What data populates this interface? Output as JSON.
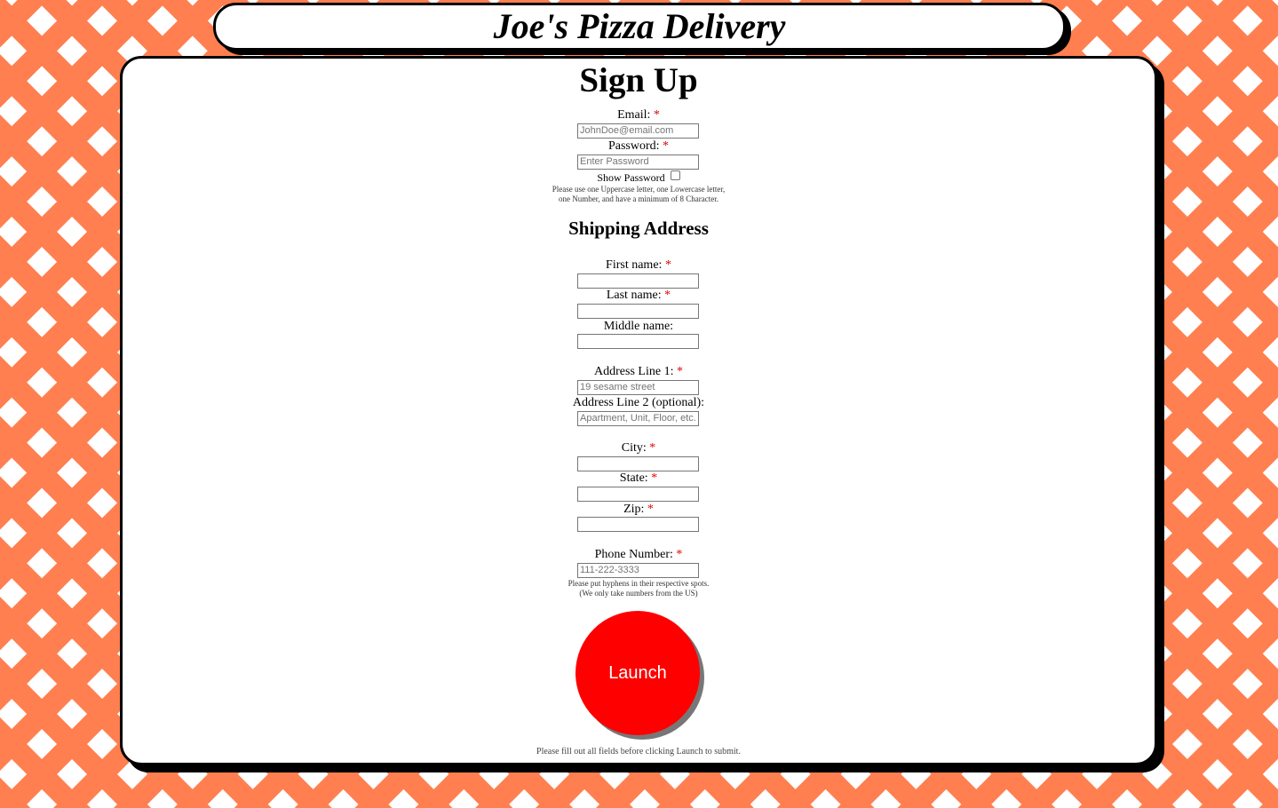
{
  "header": {
    "title": "Joe's Pizza Delivery"
  },
  "form": {
    "heading": "Sign Up",
    "email": {
      "label": "Email:",
      "required_mark": "*",
      "placeholder": "JohnDoe@email.com"
    },
    "password": {
      "label": "Password:",
      "required_mark": "*",
      "placeholder": "Enter Password"
    },
    "show_password": {
      "label": "Show Password"
    },
    "password_hint_1": "Please use one Uppercase letter, one Lowercase letter,",
    "password_hint_2": "one Number, and have a minimum of 8 Character.",
    "shipping_heading": "Shipping Address",
    "first_name": {
      "label": "First name:",
      "required_mark": "*"
    },
    "last_name": {
      "label": "Last name:",
      "required_mark": "*"
    },
    "middle_name": {
      "label": "Middle name:"
    },
    "address1": {
      "label": "Address Line 1:",
      "required_mark": "*",
      "placeholder": "19 sesame street"
    },
    "address2": {
      "label": "Address Line 2 (optional):",
      "placeholder": "Apartment, Unit, Floor, etc."
    },
    "city": {
      "label": "City:",
      "required_mark": "*"
    },
    "state": {
      "label": "State:",
      "required_mark": "*"
    },
    "zip": {
      "label": "Zip:",
      "required_mark": "*"
    },
    "phone": {
      "label": "Phone Number:",
      "required_mark": "*",
      "placeholder": "111-222-3333"
    },
    "phone_hint_1": "Please put hyphens in their respective spots.",
    "phone_hint_2": "(We only take numbers from the US)",
    "launch_label": "Launch",
    "footnote": "Please fill out all fields before clicking Launch to submit."
  },
  "colors": {
    "background_pattern": "#ff7f50",
    "launch_button": "#ff0000",
    "required_mark": "#e00000"
  }
}
